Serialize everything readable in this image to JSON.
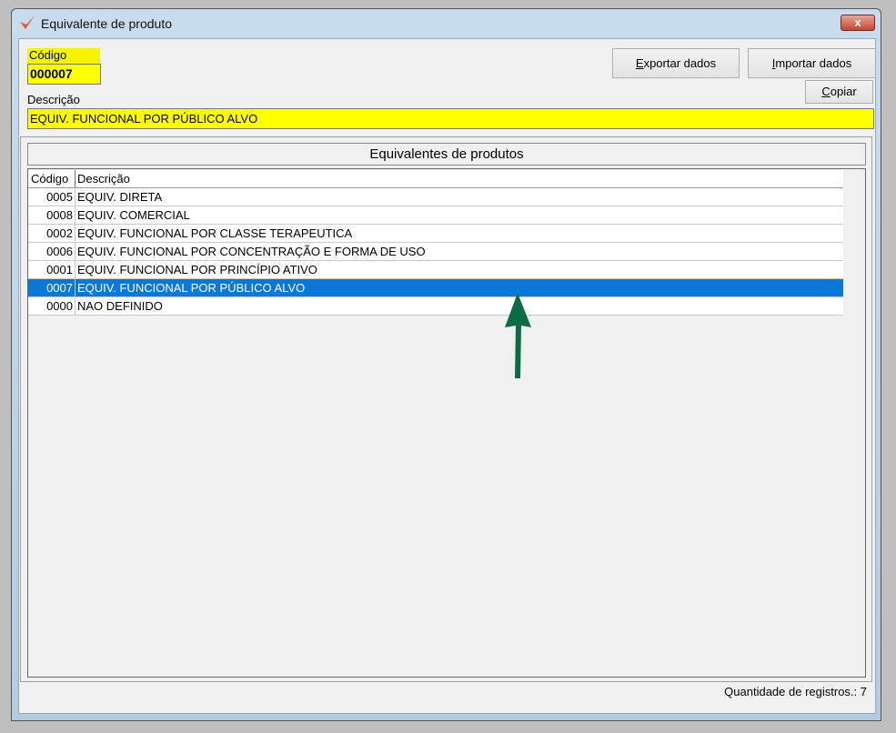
{
  "window": {
    "title": "Equivalente de produto",
    "close_label": "x"
  },
  "form": {
    "codigo_label": "Código",
    "codigo_value": "000007",
    "descricao_label": "Descrição",
    "descricao_value": "EQUIV. FUNCIONAL POR PÚBLICO ALVO"
  },
  "buttons": {
    "exportar_key": "E",
    "exportar_rest": "xportar dados",
    "importar_key": "I",
    "importar_rest": "mportar dados",
    "copiar_key": "C",
    "copiar_rest": "opiar"
  },
  "grid": {
    "title": "Equivalentes de produtos",
    "columns": [
      "Código",
      "Descrição"
    ],
    "rows": [
      {
        "codigo": "0005",
        "descricao": "EQUIV.  DIRETA"
      },
      {
        "codigo": "0008",
        "descricao": "EQUIV. COMERCIAL"
      },
      {
        "codigo": "0002",
        "descricao": "EQUIV. FUNCIONAL POR CLASSE TERAPEUTICA"
      },
      {
        "codigo": "0006",
        "descricao": "EQUIV. FUNCIONAL POR CONCENTRAÇÃO E FORMA DE USO"
      },
      {
        "codigo": "0001",
        "descricao": "EQUIV. FUNCIONAL POR PRINCÍPIO ATIVO"
      },
      {
        "codigo": "0007",
        "descricao": "EQUIV. FUNCIONAL POR PÚBLICO ALVO"
      },
      {
        "codigo": "0000",
        "descricao": "NAO DEFINIDO"
      }
    ],
    "selected_index": 5
  },
  "status": {
    "count_text": "Quantidade de registros.: 7"
  },
  "colors": {
    "selection": "#0a78d7",
    "highlight": "#ffff00",
    "arrow": "#0b6b45"
  }
}
